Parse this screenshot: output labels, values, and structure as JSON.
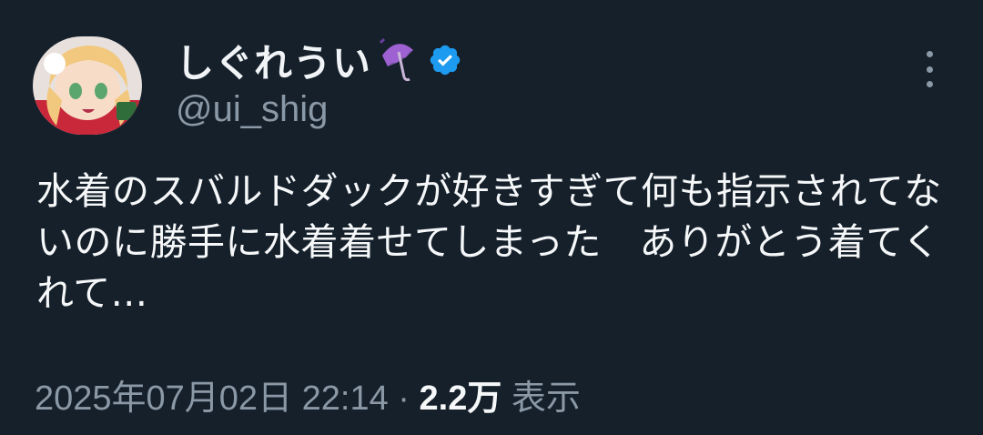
{
  "author": {
    "display_name": "しぐれうい",
    "name_emoji": "umbrella-icon",
    "verified_icon": "verified-badge-icon",
    "handle": "@ui_shig"
  },
  "tweet": {
    "text": "水着のスバルドダックが好きすぎて何も指示されてないのに勝手に水着着せてしまった　ありがとう着てくれて..."
  },
  "meta": {
    "date": "2025年07月02日",
    "time": "22:14",
    "separator": "·",
    "views": "2.2万",
    "views_label": "表示"
  },
  "colors": {
    "background": "#15202b",
    "secondary_text": "#8b98a5",
    "verified": "#1d9bf0"
  }
}
